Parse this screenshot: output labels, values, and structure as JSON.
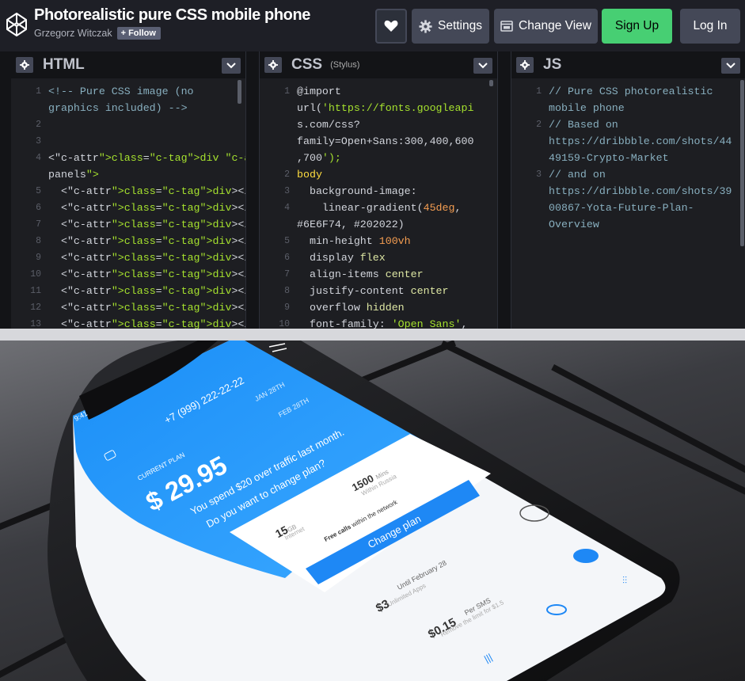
{
  "header": {
    "title": "Photorealistic pure CSS mobile phone",
    "author": "Grzegorz Witczak",
    "follow_label": "Follow",
    "settings_label": "Settings",
    "change_view_label": "Change View",
    "signup_label": "Sign Up",
    "login_label": "Log In"
  },
  "editors": {
    "html": {
      "title": "HTML",
      "lines": [
        {
          "n": "1",
          "t": "<!-- Pure CSS image (no"
        },
        {
          "n": "",
          "t": "graphics included) -->"
        },
        {
          "n": "2",
          "t": ""
        },
        {
          "n": "3",
          "t": ""
        },
        {
          "n": "4",
          "t": "<div class=\"background-"
        },
        {
          "n": "",
          "t": "panels\">"
        },
        {
          "n": "5",
          "t": "  <div></div>"
        },
        {
          "n": "6",
          "t": "  <div></div>"
        },
        {
          "n": "7",
          "t": "  <div></div>"
        },
        {
          "n": "8",
          "t": "  <div></div>"
        },
        {
          "n": "9",
          "t": "  <div></div>"
        },
        {
          "n": "10",
          "t": "  <div></div>"
        },
        {
          "n": "11",
          "t": "  <div></div>"
        },
        {
          "n": "12",
          "t": "  <div></div>"
        },
        {
          "n": "13",
          "t": "  <div></div>"
        }
      ]
    },
    "css": {
      "title": "CSS",
      "subtitle": "(Stylus)",
      "lines": [
        {
          "n": "1",
          "t": "@import"
        },
        {
          "n": "",
          "t": "url('https://fonts.googleapi"
        },
        {
          "n": "",
          "t": "s.com/css?"
        },
        {
          "n": "",
          "t": "family=Open+Sans:300,400,600"
        },
        {
          "n": "",
          "t": ",700');"
        },
        {
          "n": "2",
          "t": "body"
        },
        {
          "n": "3",
          "t": "  background-image:"
        },
        {
          "n": "4",
          "t": "    linear-gradient(45deg,"
        },
        {
          "n": "",
          "t": "#6E6F74, #202022)"
        },
        {
          "n": "5",
          "t": "  min-height 100vh"
        },
        {
          "n": "6",
          "t": "  display flex"
        },
        {
          "n": "7",
          "t": "  align-items center"
        },
        {
          "n": "8",
          "t": "  justify-content center"
        },
        {
          "n": "9",
          "t": "  overflow hidden"
        },
        {
          "n": "10",
          "t": "  font-family: 'Open Sans',"
        }
      ]
    },
    "js": {
      "title": "JS",
      "lines": [
        {
          "n": "1",
          "t": "// Pure CSS photorealistic"
        },
        {
          "n": "",
          "t": "mobile phone"
        },
        {
          "n": "2",
          "t": "// Based on"
        },
        {
          "n": "",
          "t": "https://dribbble.com/shots/44"
        },
        {
          "n": "",
          "t": "49159-Crypto-Market"
        },
        {
          "n": "3",
          "t": "// and on"
        },
        {
          "n": "",
          "t": "https://dribbble.com/shots/39"
        },
        {
          "n": "",
          "t": "00867-Yota-Future-Plan-"
        },
        {
          "n": "",
          "t": "Overview"
        }
      ]
    }
  },
  "phone": {
    "time": "9:41",
    "phone_number": "+7 (999) 222-22-22",
    "date1": "JAN 28TH",
    "date2": "FEB 28TH",
    "plan_label": "CURRENT PLAN",
    "plan_price": "$ 29.95",
    "message_line1": "You spend $20 over traffic last month.",
    "message_line2": "Do you want to change plan?",
    "data_value": "15",
    "data_unit": "GB",
    "data_label": "Internet",
    "mins_value": "1500",
    "mins_unit": "Mins",
    "mins_label": "Within Russia",
    "free_calls_bold": "Free calls",
    "free_calls_rest": "within the network",
    "change_plan_label": "Change plan",
    "item1_price": "$3",
    "item1_title": "Until February 28",
    "item1_sub": "Unlimited Apps",
    "item2_price": "$0.15",
    "item2_title": "Per SMS",
    "item2_sub": "Remove the limit for $1.5"
  },
  "colors": {
    "accent_green": "#47cf73",
    "phone_blue": "#1e88f5",
    "editor_bg": "#1d1e22"
  }
}
